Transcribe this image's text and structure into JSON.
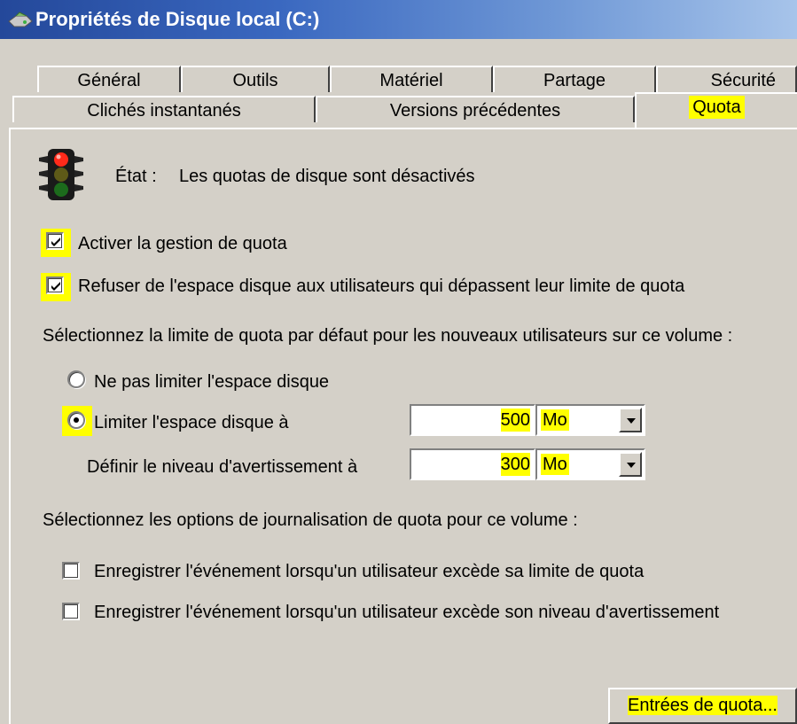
{
  "window": {
    "title": "Propriétés de Disque local (C:)",
    "icon": "drive-properties-icon"
  },
  "tabs": {
    "row1": [
      "Général",
      "Outils",
      "Matériel",
      "Partage",
      "Sécurité"
    ],
    "row2": [
      "Clichés instantanés",
      "Versions précédentes",
      "Quota"
    ],
    "active": "Quota"
  },
  "status": {
    "icon": "traffic-light-icon",
    "label": "État :",
    "text": "Les quotas de disque sont désactivés"
  },
  "options": {
    "enable_quota": {
      "label": "Activer la gestion de quota",
      "checked": true
    },
    "deny_space": {
      "label": "Refuser de l'espace disque aux utilisateurs qui dépassent leur limite de quota",
      "checked": true
    }
  },
  "default_limit": {
    "heading": "Sélectionnez la limite de quota par défaut pour les nouveaux utilisateurs sur ce volume :",
    "no_limit_label": "Ne pas limiter l'espace disque",
    "limit_label": "Limiter l'espace disque à",
    "limit_value": "500",
    "limit_unit": "Mo",
    "warning_label": "Définir le niveau d'avertissement à",
    "warning_value": "300",
    "warning_unit": "Mo",
    "selected": "limit"
  },
  "logging": {
    "heading": "Sélectionnez les options de journalisation de quota pour ce volume :",
    "log_limit_label": "Enregistrer l'événement lorsqu'un utilisateur excède sa limite de quota",
    "log_warning_label": "Enregistrer l'événement lorsqu'un utilisateur excède son niveau d'avertissement"
  },
  "buttons": {
    "entries": "Entrées de quota..."
  },
  "colors": {
    "highlight": "#ffff00",
    "dialog_bg": "#d4d0c8",
    "titlebar": "#24489a"
  }
}
